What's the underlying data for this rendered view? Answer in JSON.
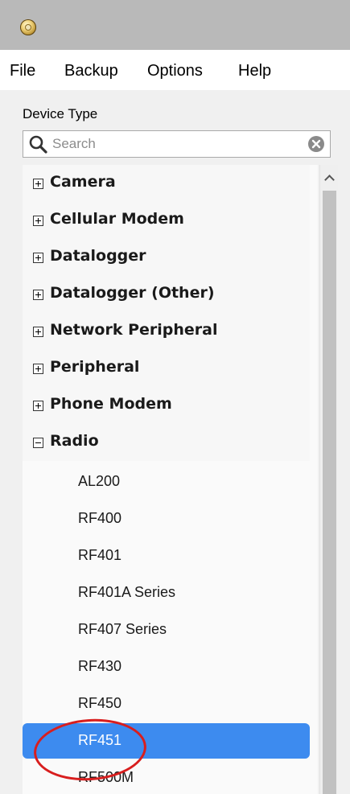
{
  "menu": {
    "file": "File",
    "backup": "Backup",
    "options": "Options",
    "help": "Help"
  },
  "panel": {
    "label": "Device Type"
  },
  "search": {
    "placeholder": "Search",
    "value": ""
  },
  "tree": {
    "categories": [
      {
        "label": "Camera",
        "expanded": false
      },
      {
        "label": "Cellular Modem",
        "expanded": false
      },
      {
        "label": "Datalogger",
        "expanded": false
      },
      {
        "label": "Datalogger (Other)",
        "expanded": false
      },
      {
        "label": "Network Peripheral",
        "expanded": false
      },
      {
        "label": "Peripheral",
        "expanded": false
      },
      {
        "label": "Phone Modem",
        "expanded": false
      },
      {
        "label": "Radio",
        "expanded": true
      }
    ],
    "radio_children": [
      {
        "label": "AL200"
      },
      {
        "label": "RF400"
      },
      {
        "label": "RF401"
      },
      {
        "label": "RF401A Series"
      },
      {
        "label": "RF407 Series"
      },
      {
        "label": "RF430"
      },
      {
        "label": "RF450"
      },
      {
        "label": "RF451",
        "selected": true
      },
      {
        "label": "RF500M"
      }
    ]
  },
  "colors": {
    "selection": "#3d8bef",
    "annotation": "#d81e1e",
    "titlebar": "#b9b9b9"
  }
}
